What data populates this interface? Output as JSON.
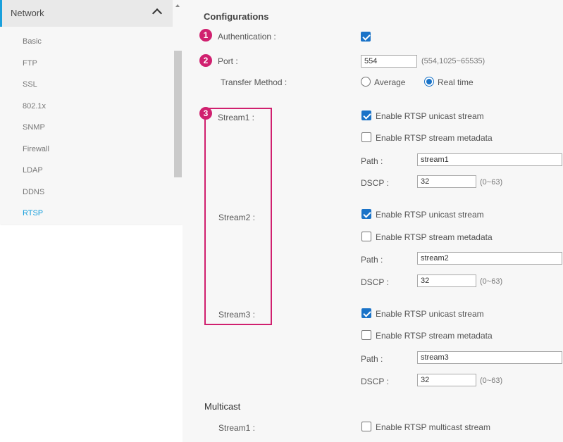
{
  "sidebar": {
    "title": "Network",
    "items": [
      {
        "label": "Basic"
      },
      {
        "label": "FTP"
      },
      {
        "label": "SSL"
      },
      {
        "label": "802.1x"
      },
      {
        "label": "SNMP"
      },
      {
        "label": "Firewall"
      },
      {
        "label": "LDAP"
      },
      {
        "label": "DDNS"
      },
      {
        "label": "RTSP",
        "active": true
      }
    ]
  },
  "main": {
    "configurations_title": "Configurations",
    "badges": [
      "1",
      "2",
      "3"
    ],
    "authentication": {
      "label": "Authentication :",
      "checked": true
    },
    "port": {
      "label": "Port :",
      "value": "554",
      "hint": "(554,1025~65535)"
    },
    "transfer_method": {
      "label": "Transfer Method :",
      "options": [
        "Average",
        "Real time"
      ],
      "selected": "Real time"
    },
    "streams": [
      {
        "label": "Stream1 :",
        "unicast_label": "Enable RTSP unicast stream",
        "unicast_checked": true,
        "metadata_label": "Enable RTSP stream metadata",
        "metadata_checked": false,
        "path_label": "Path :",
        "path_value": "stream1",
        "dscp_label": "DSCP :",
        "dscp_value": "32",
        "dscp_hint": "(0~63)"
      },
      {
        "label": "Stream2 :",
        "unicast_label": "Enable RTSP unicast stream",
        "unicast_checked": true,
        "metadata_label": "Enable RTSP stream metadata",
        "metadata_checked": false,
        "path_label": "Path :",
        "path_value": "stream2",
        "dscp_label": "DSCP :",
        "dscp_value": "32",
        "dscp_hint": "(0~63)"
      },
      {
        "label": "Stream3 :",
        "unicast_label": "Enable RTSP unicast stream",
        "unicast_checked": true,
        "metadata_label": "Enable RTSP stream metadata",
        "metadata_checked": false,
        "path_label": "Path :",
        "path_value": "stream3",
        "dscp_label": "DSCP :",
        "dscp_value": "32",
        "dscp_hint": "(0~63)"
      }
    ],
    "multicast": {
      "title": "Multicast",
      "stream1_label": "Stream1 :",
      "stream1_option": "Enable RTSP multicast stream",
      "stream1_checked": false
    }
  },
  "colors": {
    "accent": "#1aa0dc",
    "annotation": "#d0206f",
    "checkbox": "#1a73c8"
  }
}
